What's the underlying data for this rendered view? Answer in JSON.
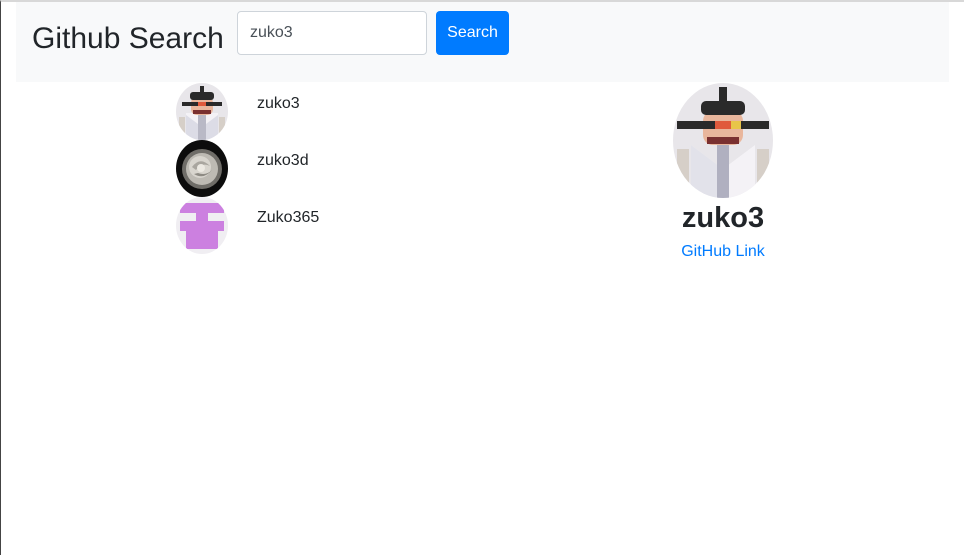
{
  "header": {
    "brand": "Github Search",
    "search_value": "zuko3",
    "search_button_label": "Search"
  },
  "results": [
    {
      "login": "zuko3",
      "avatar": "samurai-avatar-icon"
    },
    {
      "login": "zuko3d",
      "avatar": "rose-avatar-icon"
    },
    {
      "login": "Zuko365",
      "avatar": "identicon-avatar-icon"
    }
  ],
  "profile": {
    "login": "zuko3",
    "link_label": "GitHub Link",
    "avatar": "samurai-avatar-icon"
  },
  "colors": {
    "primary": "#007bff",
    "navbar_bg": "#f8f9fa",
    "identicon": "#cc80e0"
  }
}
